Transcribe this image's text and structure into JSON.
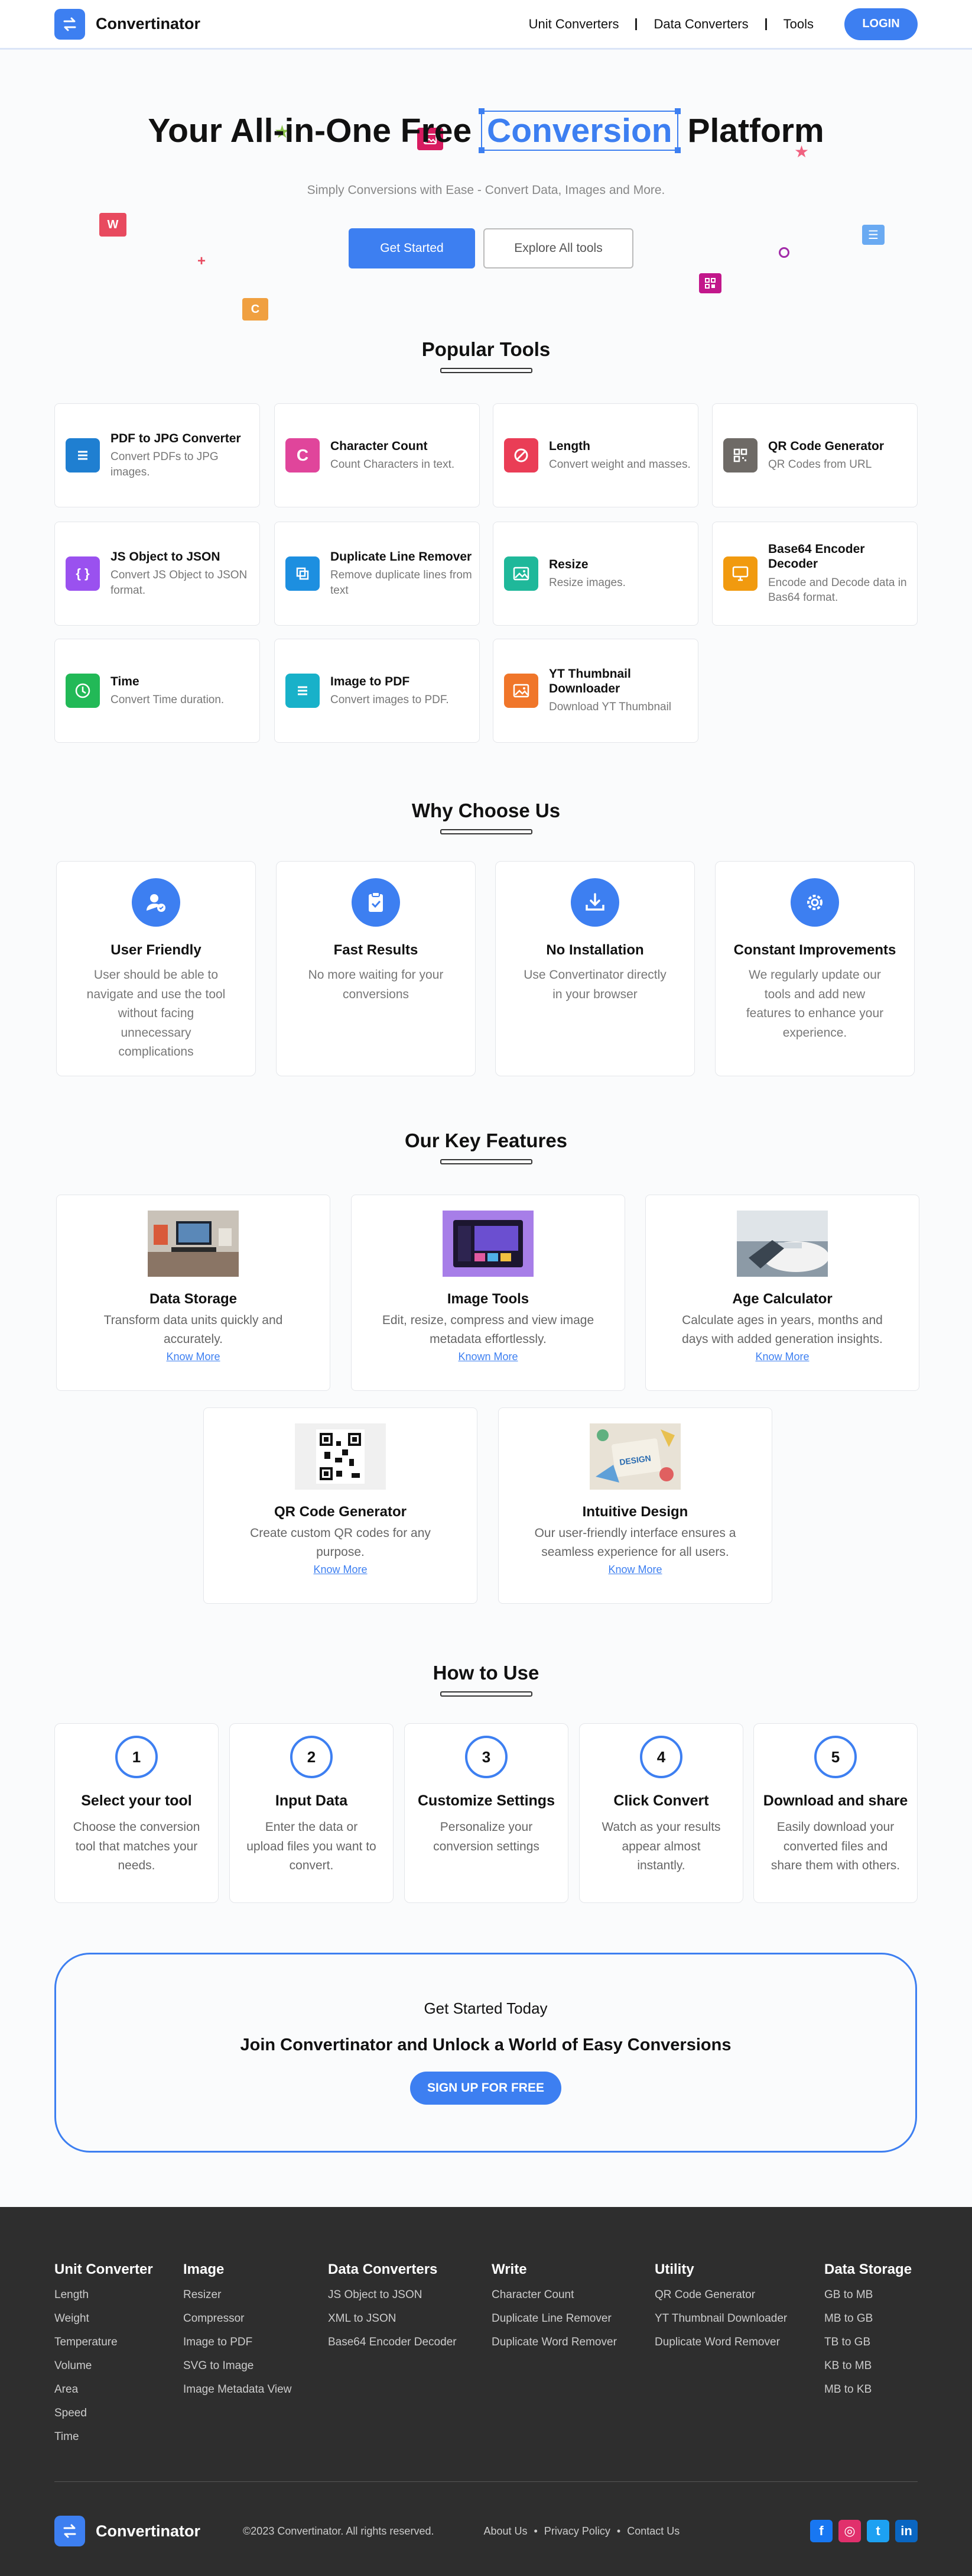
{
  "header": {
    "brand": "Convertinator",
    "nav": [
      "Unit Converters",
      "Data Converters",
      "Tools"
    ],
    "login": "LOGIN"
  },
  "hero": {
    "title_before": "Your All-in-One Free",
    "title_highlight": "Conversion",
    "title_after": "Platform",
    "subtitle": "Simply Conversions with Ease - Convert Data, Images and More.",
    "primary_cta": "Get Started",
    "secondary_cta": "Explore All tools",
    "decorations": {
      "w": "W",
      "c": "C"
    }
  },
  "popular": {
    "title": "Popular Tools",
    "tools": [
      {
        "name": "PDF to JPG Converter",
        "desc": "Convert PDFs to JPG images.",
        "color": "#1f7fd1",
        "icon": "list-icon"
      },
      {
        "name": "Character Count",
        "desc": "Count Characters in text.",
        "color": "#e0459b",
        "icon": "c-letter-icon",
        "glyph": "C"
      },
      {
        "name": "Length",
        "desc": "Convert weight and masses.",
        "color": "#ea3d56",
        "icon": "ruler-icon"
      },
      {
        "name": "QR Code Generator",
        "desc": "QR Codes from URL",
        "color": "#6e6a66",
        "icon": "qr-icon"
      },
      {
        "name": "JS Object to JSON",
        "desc": "Convert JS Object to JSON format.",
        "color": "#9a51ef",
        "icon": "braces-icon",
        "glyph": "{ }"
      },
      {
        "name": "Duplicate Line Remover",
        "desc": "Remove duplicate lines from text",
        "color": "#1d8fe0",
        "icon": "copy-icon"
      },
      {
        "name": "Resize",
        "desc": "Resize images.",
        "color": "#1fb89a",
        "icon": "image-icon"
      },
      {
        "name": "Base64 Encoder Decoder",
        "desc": "Encode and Decode data in Bas64 format.",
        "color": "#f19a0f",
        "icon": "monitor-icon"
      },
      {
        "name": "Time",
        "desc": "Convert Time duration.",
        "color": "#22b957",
        "icon": "clock-icon"
      },
      {
        "name": "Image to PDF",
        "desc": "Convert images to PDF.",
        "color": "#18b1c9",
        "icon": "list-icon"
      },
      {
        "name": "YT Thumbnail Downloader",
        "desc": "Download YT Thumbnail",
        "color": "#f0762a",
        "icon": "image-icon"
      }
    ]
  },
  "why": {
    "title": "Why Choose Us",
    "items": [
      {
        "title": "User Friendly",
        "desc": "User should be able to navigate and use the tool without facing unnecessary complications",
        "icon": "user-check-icon"
      },
      {
        "title": "Fast Results",
        "desc": "No more waiting for your conversions",
        "icon": "clipboard-check-icon"
      },
      {
        "title": "No Installation",
        "desc": "Use Convertinator directly in your browser",
        "icon": "download-icon"
      },
      {
        "title": "Constant Improvements",
        "desc": "We regularly update our tools and add new features to enhance your experience.",
        "icon": "gear-icon"
      }
    ]
  },
  "features": {
    "title": "Our Key Features",
    "items": [
      {
        "title": "Data Storage",
        "desc": "Transform data units quickly and accurately.",
        "link": "Know More"
      },
      {
        "title": "Image Tools",
        "desc": "Edit, resize, compress and view image metadata effortlessly.",
        "link": "Known More"
      },
      {
        "title": "Age Calculator",
        "desc": "Calculate ages in years, months and days with added generation insights.",
        "link": "Know More"
      },
      {
        "title": "QR Code Generator",
        "desc": "Create custom QR codes for any purpose.",
        "link": "Know More"
      },
      {
        "title": "Intuitive Design",
        "desc": "Our user-friendly interface ensures a seamless experience for all users.",
        "link": "Know More",
        "image_text": "DESIGN"
      }
    ]
  },
  "how": {
    "title": "How to Use",
    "steps": [
      {
        "num": "1",
        "title": "Select your tool",
        "desc": "Choose the conversion tool that matches your needs."
      },
      {
        "num": "2",
        "title": "Input Data",
        "desc": "Enter the data or upload files you want to convert."
      },
      {
        "num": "3",
        "title": "Customize Settings",
        "desc": "Personalize your conversion settings"
      },
      {
        "num": "4",
        "title": "Click Convert",
        "desc": "Watch as your results appear almost instantly."
      },
      {
        "num": "5",
        "title": "Download and share",
        "desc": "Easily download your converted files and share them with others."
      }
    ]
  },
  "cta": {
    "line1": "Get Started Today",
    "line2": "Join Convertinator and Unlock a World of Easy Conversions",
    "button": "SIGN UP FOR FREE"
  },
  "footer": {
    "columns": [
      {
        "title": "Unit Converter",
        "items": [
          "Length",
          "Weight",
          "Temperature",
          "Volume",
          "Area",
          "Speed",
          "Time"
        ]
      },
      {
        "title": "Image",
        "items": [
          "Resizer",
          "Compressor",
          "Image to PDF",
          "SVG to Image",
          "Image Metadata View"
        ]
      },
      {
        "title": "Data Converters",
        "items": [
          "JS Object to JSON",
          "XML to JSON",
          "Base64 Encoder Decoder"
        ]
      },
      {
        "title": "Write",
        "items": [
          "Character Count",
          "Duplicate Line Remover",
          "Duplicate Word Remover"
        ]
      },
      {
        "title": "Utility",
        "items": [
          "QR Code Generator",
          "YT Thumbnail Downloader",
          "Duplicate Word Remover"
        ]
      },
      {
        "title": "Data Storage",
        "items": [
          "GB to MB",
          "MB to GB",
          "TB to GB",
          "KB to MB",
          "MB to KB"
        ]
      }
    ],
    "brand": "Convertinator",
    "copyright": "©2023 Convertinator. All rights reserved.",
    "links": [
      "About Us",
      "Privacy Policy",
      "Contact Us"
    ],
    "separator": "•",
    "social": [
      {
        "name": "facebook-icon",
        "color": "#1877f2",
        "glyph": "f"
      },
      {
        "name": "instagram-icon",
        "color": "#e1306c",
        "glyph": "◎"
      },
      {
        "name": "twitter-icon",
        "color": "#1da1f2",
        "glyph": "t"
      },
      {
        "name": "linkedin-icon",
        "color": "#0a66c2",
        "glyph": "in"
      }
    ]
  }
}
